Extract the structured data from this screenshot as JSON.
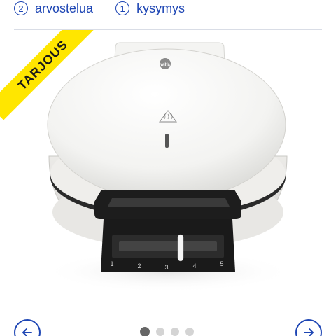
{
  "meta": {
    "reviews": {
      "count": "2",
      "label": "arvostelua"
    },
    "questions": {
      "count": "1",
      "label": "kysymys"
    }
  },
  "badge": {
    "label": "TARJOUS",
    "color": "#ffe600"
  },
  "product": {
    "brand": "wilfa",
    "dial_numbers": [
      "1",
      "2",
      "3",
      "4",
      "5"
    ]
  },
  "carousel": {
    "total_slides": 4,
    "active_index": 0,
    "prev_icon": "arrow-left-icon",
    "next_icon": "arrow-right-icon"
  },
  "colors": {
    "accent": "#1e46b4",
    "badge": "#ffe600"
  }
}
